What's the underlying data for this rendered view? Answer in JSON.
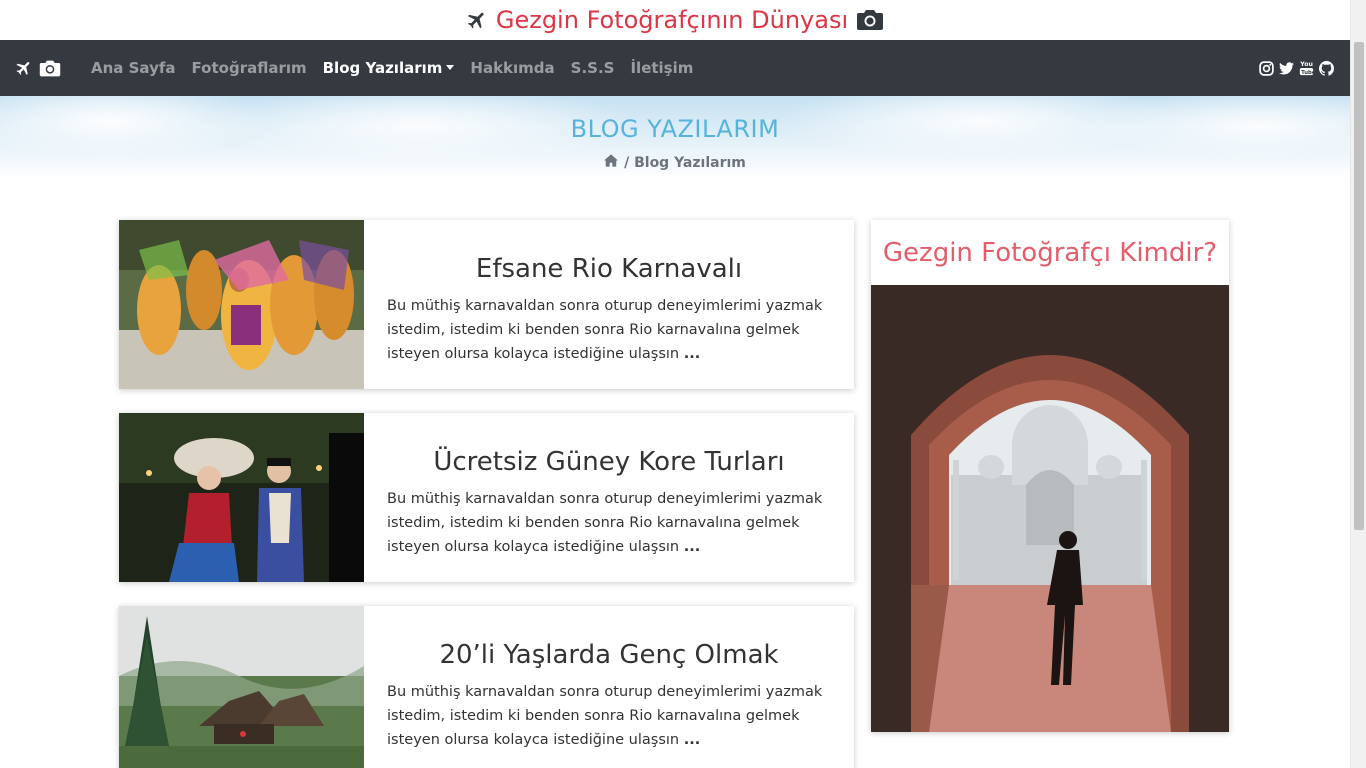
{
  "site_title": "Gezgin Fotoğrafçının Dünyası",
  "nav": {
    "items": [
      {
        "label": "Ana Sayfa",
        "active": false
      },
      {
        "label": "Fotoğraflarım",
        "active": false
      },
      {
        "label": "Blog Yazılarım",
        "active": true,
        "dropdown": true
      },
      {
        "label": "Hakkımda",
        "active": false
      },
      {
        "label": "S.S.S",
        "active": false
      },
      {
        "label": "İletişim",
        "active": false
      }
    ],
    "social_icons": [
      "instagram-icon",
      "twitter-icon",
      "youtube-icon",
      "github-icon"
    ]
  },
  "hero": {
    "title": "BLOG YAZILARIM",
    "breadcrumb": "/ Blog Yazılarım"
  },
  "posts": [
    {
      "title": "Efsane Rio Karnavalı",
      "excerpt": "Bu müthiş karnavaldan sonra oturup deneyimlerimi yazmak istedim, istedim ki benden sonra Rio karnavalına gelmek isteyen olursa kolayca istediğine ulaşsın",
      "more": "..."
    },
    {
      "title": "Ücretsiz Güney Kore Turları",
      "excerpt": "Bu müthiş karnavaldan sonra oturup deneyimlerimi yazmak istedim, istedim ki benden sonra Rio karnavalına gelmek isteyen olursa kolayca istediğine ulaşsın",
      "more": "..."
    },
    {
      "title": "20’li Yaşlarda Genç Olmak",
      "excerpt": "Bu müthiş karnavaldan sonra oturup deneyimlerimi yazmak istedim, istedim ki benden sonra Rio karnavalına gelmek isteyen olursa kolayca istediğine ulaşsın",
      "more": "..."
    }
  ],
  "sidebar": {
    "title": "Gezgin Fotoğrafçı Kimdir?"
  },
  "colors": {
    "brand": "#dc3545",
    "navbar": "#343a40",
    "hero_title": "#56b4dc",
    "sidebar_title": "#e35d6a"
  }
}
